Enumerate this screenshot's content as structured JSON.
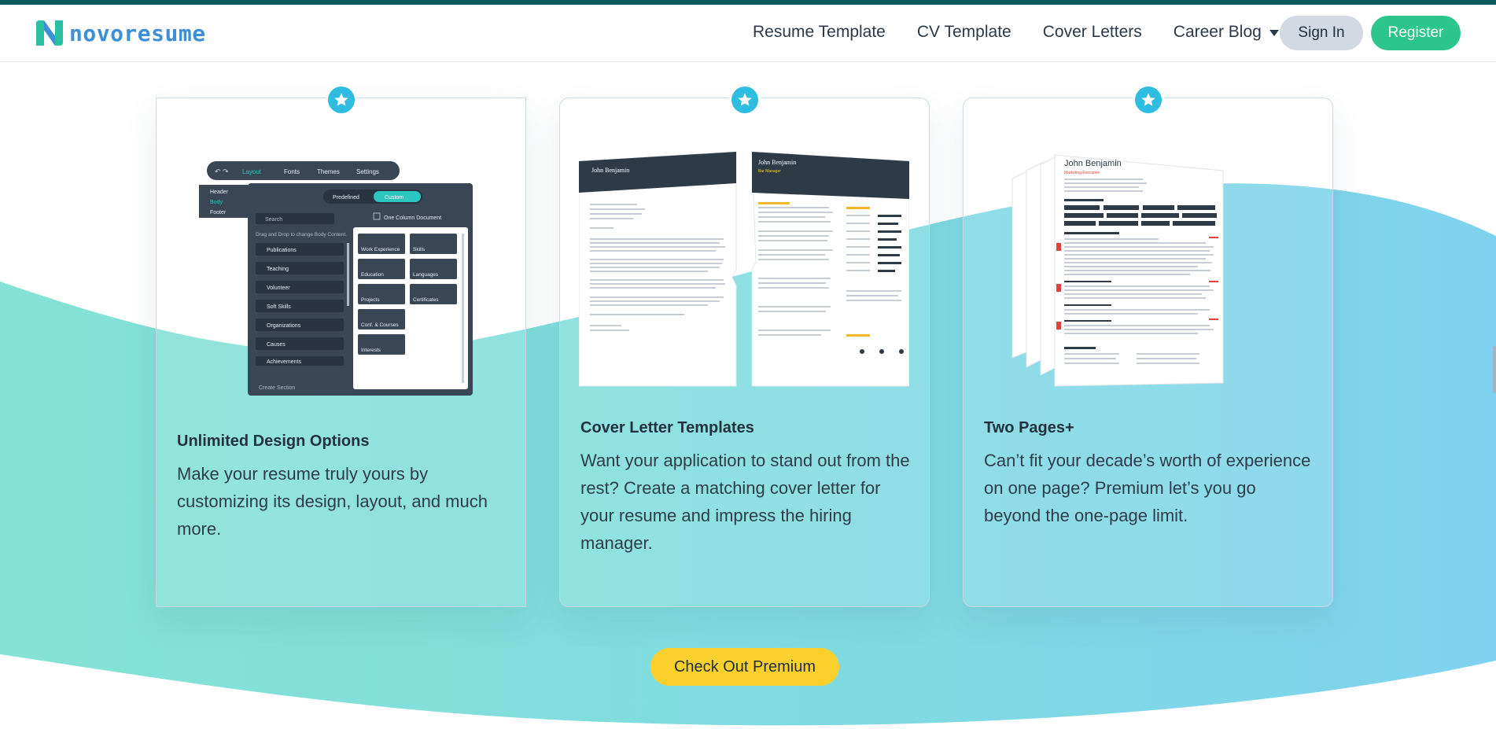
{
  "brand": {
    "name": "novoresume",
    "color": "#3d8fd6"
  },
  "nav": {
    "links": [
      "Resume Template",
      "CV Template",
      "Cover Letters",
      "Career Blog"
    ],
    "signin": "Sign In",
    "register": "Register"
  },
  "cards": [
    {
      "title": "Unlimited Design Options",
      "body": "Make your resume truly yours by customizing its design, layout, and much more.",
      "icon": "star-icon",
      "illustration": {
        "toolbar": [
          "Layout",
          "Fonts",
          "Themes",
          "Settings"
        ],
        "sections": [
          "Header",
          "Body",
          "Footer"
        ],
        "toggle": [
          "Predefined",
          "Custom"
        ],
        "search_placeholder": "Search",
        "one_column": "One Column Document",
        "drag_hint": "Drag and Drop to change Body Content.",
        "left_items": [
          "Publications",
          "Teaching",
          "Volunteer",
          "Soft Skills",
          "Organizations",
          "Causes",
          "Achievements"
        ],
        "right_items": [
          "Work Experience",
          "Skills",
          "Education",
          "Languages",
          "Projects",
          "Certificates",
          "Conf. & Courses",
          "Interests"
        ],
        "create_section": "Create Section"
      }
    },
    {
      "title": "Cover Letter Templates",
      "body": "Want your application to stand out from the rest? Create a matching cover letter for your resume and impress the hiring manager.",
      "icon": "star-icon",
      "illustration": {
        "name": "John Benjamin",
        "role": "Bar Manager"
      }
    },
    {
      "title": "Two Pages+",
      "body": "Can’t fit your decade’s worth of experience on one page? Premium let’s you go beyond the one-page limit.",
      "icon": "star-icon",
      "illustration": {
        "name": "John Benjamin",
        "role": "Marketing Executive"
      }
    }
  ],
  "cta": "Check Out Premium",
  "colors": {
    "accent_green": "#2dc58e",
    "accent_yellow": "#fcd02c",
    "star_blue": "#2ebde0",
    "wave_left": "#7fe0d2",
    "wave_right": "#7fd4ee"
  }
}
